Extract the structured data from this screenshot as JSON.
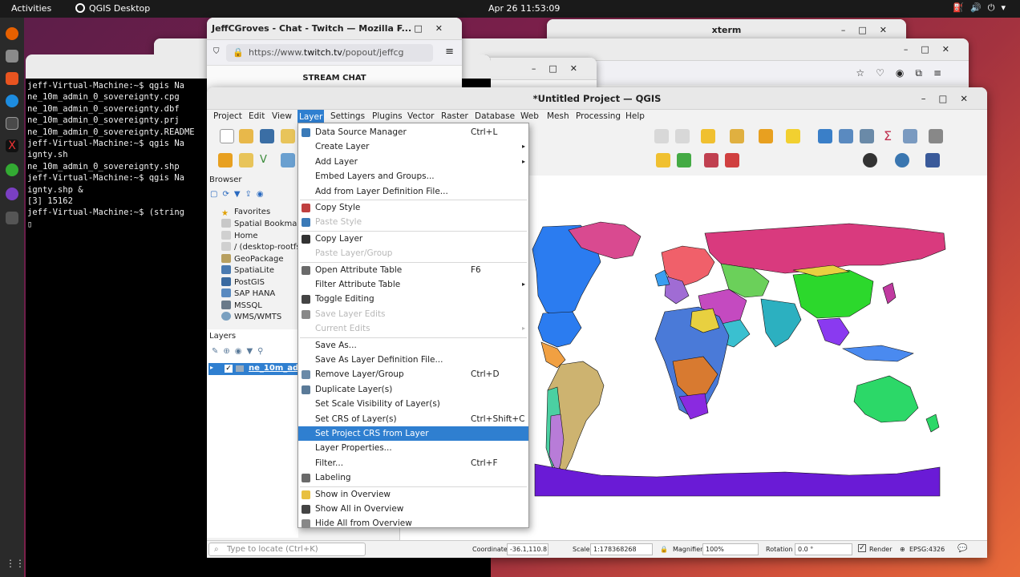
{
  "topbar": {
    "activities": "Activities",
    "app_name": "QGIS Desktop",
    "clock": "Apr 26  11:53:09"
  },
  "terminal": {
    "lines": [
      "jeff-Virtual-Machine:~$ qgis Na",
      "ne_10m_admin_0_sovereignty.cpg",
      "ne_10m_admin_0_sovereignty.dbf",
      "ne_10m_admin_0_sovereignty.prj",
      "ne_10m_admin_0_sovereignty.README",
      "jeff-Virtual-Machine:~$ qgis Na",
      "ignty.sh",
      "ne_10m_admin_0_sovereignty.shp",
      "jeff-Virtual-Machine:~$ qgis Na",
      "ignty.shp &",
      "[3] 15162",
      "jeff-Virtual-Machine:~$ (string",
      "▯"
    ]
  },
  "twitch": {
    "title": "JeffCGroves - Chat - Twitch — Mozilla F...",
    "url_prefix": "https://www.",
    "url_host": "twitch.tv",
    "url_rest": "/popout/jeffcg",
    "stream_chat": "STREAM CHAT"
  },
  "xterm": {
    "title": "xterm"
  },
  "qgis": {
    "title": "*Untitled Project — QGIS",
    "menus": [
      "Project",
      "Edit",
      "View",
      "Layer",
      "Settings",
      "Plugins",
      "Vector",
      "Raster",
      "Database",
      "Web",
      "Mesh",
      "Processing",
      "Help"
    ],
    "browser": {
      "title": "Browser",
      "items": [
        "Favorites",
        "Spatial Bookmar",
        "Home",
        "/ (desktop-rootfs",
        "GeoPackage",
        "SpatiaLite",
        "PostGIS",
        "SAP HANA",
        "MSSQL",
        "WMS/WMTS"
      ]
    },
    "layers": {
      "title": "Layers",
      "layer_name": "ne_10m_ad"
    },
    "status": {
      "locator_placeholder": "Type to locate (Ctrl+K)",
      "coordinate_label": "Coordinate",
      "coordinate_value": "-36.1,110.8",
      "scale_label": "Scale",
      "scale_value": "1:178368268",
      "magnifier_label": "Magnifier",
      "magnifier_value": "100%",
      "rotation_label": "Rotation",
      "rotation_value": "0.0 °",
      "render_label": "Render",
      "crs": "EPSG:4326"
    }
  },
  "layer_menu": {
    "items": [
      {
        "label": "Data Source Manager",
        "shortcut": "Ctrl+L",
        "icon": "data-source-icon"
      },
      {
        "label": "Create Layer",
        "submenu": true
      },
      {
        "label": "Add Layer",
        "submenu": true
      },
      {
        "label": "Embed Layers and Groups..."
      },
      {
        "label": "Add from Layer Definition File..."
      },
      {
        "label": "Copy Style",
        "icon": "copy-style-icon",
        "sep_before": true
      },
      {
        "label": "Paste Style",
        "disabled": true,
        "icon": "paste-style-icon"
      },
      {
        "label": "Copy Layer",
        "icon": "copy-layer-icon",
        "sep_before": true
      },
      {
        "label": "Paste Layer/Group",
        "disabled": true
      },
      {
        "label": "Open Attribute Table",
        "shortcut": "F6",
        "icon": "attribute-table-icon",
        "sep_before": true
      },
      {
        "label": "Filter Attribute Table",
        "submenu": true
      },
      {
        "label": "Toggle Editing",
        "icon": "pencil-icon"
      },
      {
        "label": "Save Layer Edits",
        "disabled": true,
        "icon": "save-edits-icon"
      },
      {
        "label": "Current Edits",
        "disabled": true,
        "submenu": true
      },
      {
        "label": "Save As...",
        "sep_before": true
      },
      {
        "label": "Save As Layer Definition File..."
      },
      {
        "label": "Remove Layer/Group",
        "shortcut": "Ctrl+D",
        "icon": "remove-layer-icon"
      },
      {
        "label": "Duplicate Layer(s)",
        "icon": "duplicate-icon"
      },
      {
        "label": "Set Scale Visibility of Layer(s)"
      },
      {
        "label": "Set CRS of Layer(s)",
        "shortcut": "Ctrl+Shift+C"
      },
      {
        "label": "Set Project CRS from Layer",
        "highlighted": true
      },
      {
        "label": "Layer Properties..."
      },
      {
        "label": "Filter...",
        "shortcut": "Ctrl+F"
      },
      {
        "label": "Labeling",
        "icon": "labeling-icon"
      },
      {
        "label": "Show in Overview",
        "icon": "overview-icon",
        "sep_before": true
      },
      {
        "label": "Show All in Overview",
        "icon": "overview-all-icon"
      },
      {
        "label": "Hide All from Overview",
        "icon": "overview-hide-icon"
      }
    ]
  },
  "colors": {
    "accent": "#2f7fd0",
    "ocean_blank": "#ffffff",
    "antarctica": "#6a1bd6"
  }
}
